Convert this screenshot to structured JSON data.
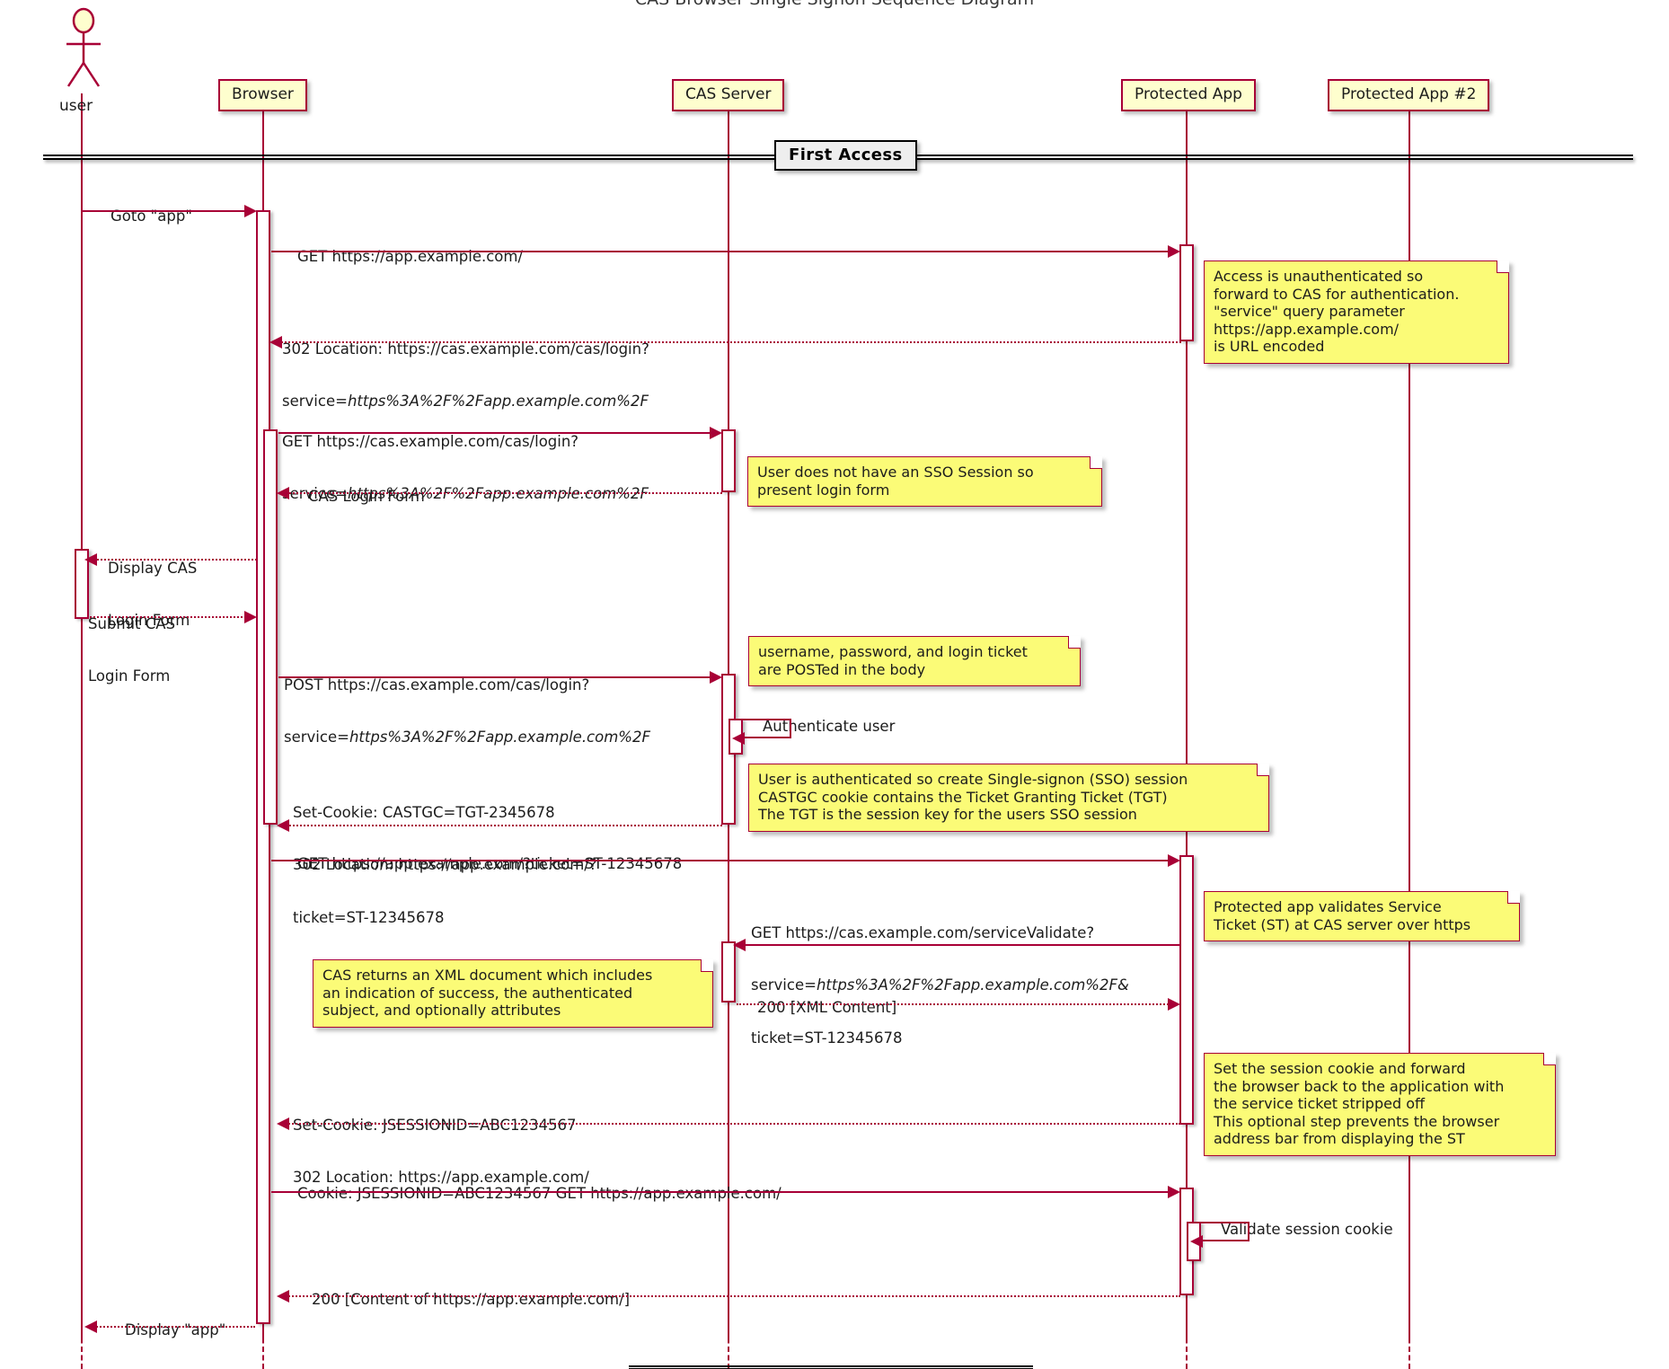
{
  "diagram": {
    "title": "CAS Browser Single Signon Sequence Diagram",
    "type": "sequence-diagram",
    "colors": {
      "participant_fill": "#FEFECE",
      "participant_border": "#A80036",
      "note_fill": "#FBFB77",
      "arrow": "#A80036",
      "divider_fill": "#EEEEEE"
    }
  },
  "participants": [
    {
      "name": "user",
      "kind": "actor"
    },
    {
      "name": "Browser",
      "kind": "participant"
    },
    {
      "name": "CAS Server",
      "kind": "participant"
    },
    {
      "name": "Protected App",
      "kind": "participant"
    },
    {
      "name": "Protected App #2",
      "kind": "participant"
    }
  ],
  "dividers": [
    {
      "label": "First Access"
    }
  ],
  "messages": [
    {
      "id": "m1",
      "from": "user",
      "to": "Browser",
      "style": "solid",
      "line1": "Goto \"app\""
    },
    {
      "id": "m2",
      "from": "Browser",
      "to": "Protected App",
      "style": "solid",
      "line1": "GET https://app.example.com/"
    },
    {
      "id": "m3",
      "from": "Protected App",
      "to": "Browser",
      "style": "dotted",
      "line1": "302 Location: https://cas.example.com/cas/login?",
      "line2_pre": "service=",
      "line2_em": "https%3A%2F%2Fapp.example.com%2F"
    },
    {
      "id": "m4",
      "from": "Browser",
      "to": "CAS Server",
      "style": "solid",
      "line1": "GET https://cas.example.com/cas/login?",
      "line2_pre": "service=",
      "line2_em": "https%3A%2F%2Fapp.example.com%2F"
    },
    {
      "id": "m5",
      "from": "CAS Server",
      "to": "Browser",
      "style": "dotted",
      "line1": "CAS Login Form"
    },
    {
      "id": "m6",
      "from": "Browser",
      "to": "user",
      "style": "dotted",
      "line1": "Display CAS",
      "line2_pre": "Login Form"
    },
    {
      "id": "m7",
      "from": "user",
      "to": "Browser",
      "style": "dotted",
      "line1": "Submit CAS",
      "line2_pre": "Login Form"
    },
    {
      "id": "m8",
      "from": "Browser",
      "to": "CAS Server",
      "style": "solid",
      "line1": "POST https://cas.example.com/cas/login?",
      "line2_pre": "service=",
      "line2_em": "https%3A%2F%2Fapp.example.com%2F"
    },
    {
      "id": "m9",
      "from": "CAS Server",
      "to": "CAS Server",
      "style": "self",
      "line1": "Authenticate user"
    },
    {
      "id": "m10",
      "from": "CAS Server",
      "to": "Browser",
      "style": "dotted",
      "line1": "Set-Cookie: CASTGC=TGT-2345678",
      "line2_pre": "302 Location: https://app.example.com/?",
      "line3": "ticket=ST-12345678"
    },
    {
      "id": "m11",
      "from": "Browser",
      "to": "Protected App",
      "style": "solid",
      "line1": "GET https://app.example.com/?ticket=ST-12345678"
    },
    {
      "id": "m12",
      "from": "Protected App",
      "to": "CAS Server",
      "style": "solid",
      "line1": "GET https://cas.example.com/serviceValidate?",
      "line2_pre": "service=",
      "line2_em": "https%3A%2F%2Fapp.example.com%2F&",
      "line3": "ticket=ST-12345678"
    },
    {
      "id": "m13",
      "from": "CAS Server",
      "to": "Protected App",
      "style": "dotted",
      "line1": "200 [XML Content]"
    },
    {
      "id": "m14",
      "from": "Protected App",
      "to": "Browser",
      "style": "dotted",
      "line1": "Set-Cookie: JSESSIONID=ABC1234567",
      "line2_pre": "302 Location: https://app.example.com/"
    },
    {
      "id": "m15",
      "from": "Browser",
      "to": "Protected App",
      "style": "solid",
      "line1": "Cookie: JSESSIONID=ABC1234567 GET https://app.example.com/"
    },
    {
      "id": "m16",
      "from": "Protected App",
      "to": "Protected App",
      "style": "self",
      "line1": "Validate session cookie"
    },
    {
      "id": "m17",
      "from": "Protected App",
      "to": "Browser",
      "style": "dotted",
      "line1": "200 [Content of https://app.example.com/]"
    },
    {
      "id": "m18",
      "from": "Browser",
      "to": "user",
      "style": "dotted",
      "line1": "Display \"app\""
    }
  ],
  "notes": [
    {
      "id": "n1",
      "text": "Access is unauthenticated so\nforward to CAS for authentication.\n\"service\" query parameter\nhttps://app.example.com/\nis URL encoded"
    },
    {
      "id": "n2",
      "text": "User does not have an SSO Session so\npresent login form"
    },
    {
      "id": "n3",
      "text": "username, password, and login ticket\nare POSTed in the body"
    },
    {
      "id": "n4",
      "text": "User is authenticated so create Single-signon (SSO) session\nCASTGC cookie contains the Ticket Granting Ticket (TGT)\nThe TGT is the session key for the users SSO session"
    },
    {
      "id": "n5",
      "text": "Protected app validates Service\nTicket (ST) at CAS server over https"
    },
    {
      "id": "n6",
      "text": "CAS returns an XML document which includes\nan indication of success, the authenticated\nsubject, and optionally attributes"
    },
    {
      "id": "n7",
      "text": "Set the session cookie and forward\nthe browser back to the application with\nthe service ticket stripped off\nThis optional step prevents the browser\naddress bar from displaying the ST"
    }
  ]
}
